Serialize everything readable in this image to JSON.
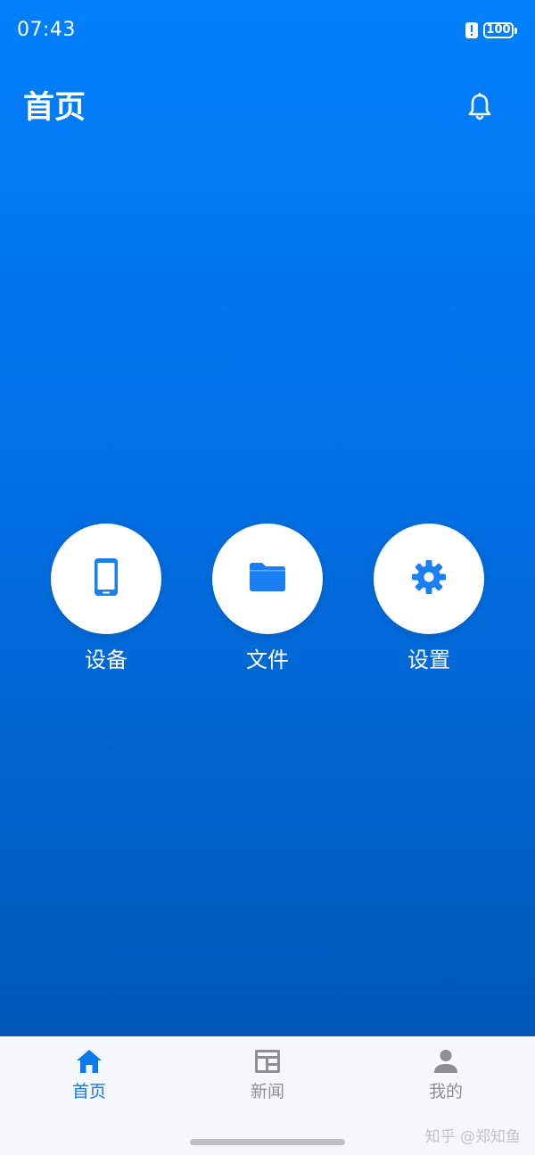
{
  "status_bar": {
    "time": "07:43",
    "battery": "100"
  },
  "header": {
    "title": "首页",
    "bell_icon": "bell-outline-icon"
  },
  "actions": [
    {
      "label": "设备",
      "icon": "smartphone-icon"
    },
    {
      "label": "文件",
      "icon": "folder-icon"
    },
    {
      "label": "设置",
      "icon": "gear-icon"
    }
  ],
  "tab_bar": {
    "tabs": [
      {
        "label": "首页",
        "icon": "home-icon",
        "active": true
      },
      {
        "label": "新闻",
        "icon": "newspaper-icon",
        "active": false
      },
      {
        "label": "我的",
        "icon": "person-icon",
        "active": false
      }
    ]
  },
  "watermark": "知乎 @郑知鱼",
  "colors": {
    "gradient_top": "#0180fb",
    "gradient_bottom": "#0059b9",
    "accent": "#0a7cf0",
    "tab_bar_bg": "#f6f7fb",
    "inactive_tab": "#8e8e93",
    "icon_blue": "#1a7ff0"
  }
}
